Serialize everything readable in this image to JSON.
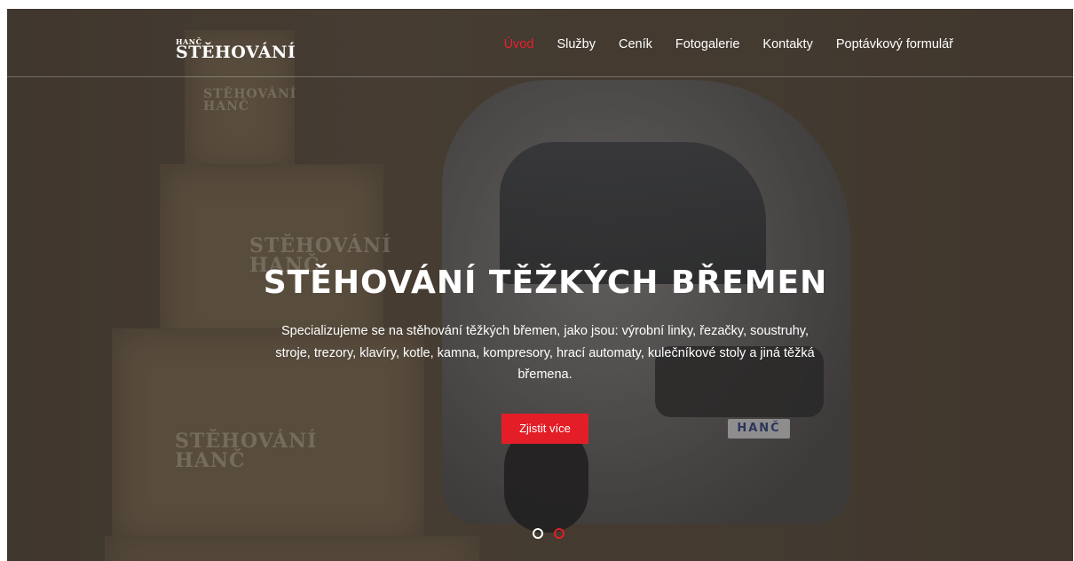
{
  "logo": {
    "small": "HANČ",
    "main": "STĚHOVÁNÍ"
  },
  "nav": {
    "items": [
      {
        "label": "Úvod",
        "active": true
      },
      {
        "label": "Služby",
        "active": false
      },
      {
        "label": "Ceník",
        "active": false
      },
      {
        "label": "Fotogalerie",
        "active": false
      },
      {
        "label": "Kontakty",
        "active": false
      },
      {
        "label": "Poptávkový formulář",
        "active": false
      }
    ]
  },
  "hero": {
    "title": "STĚHOVÁNÍ TĚŽKÝCH BŘEMEN",
    "text": "Specializujeme se na stěhování těžkých břemen, jako jsou: výrobní linky, řezačky, soustruhy, stroje, trezory, klavíry, kotle, kamna, kompresory, hrací automaty, kulečníkové stoly a jiná těžká břemena.",
    "cta_label": "Zjistit více",
    "slides": 2,
    "active_slide": 2
  },
  "photo": {
    "box_stamp_line1": "STĚHOVÁNÍ",
    "box_stamp_line2": "HANČ",
    "plate_text": "HANČ"
  },
  "colors": {
    "accent": "#e31e26",
    "nav_active": "#e8202c",
    "hero_bg": "#4e4439"
  }
}
